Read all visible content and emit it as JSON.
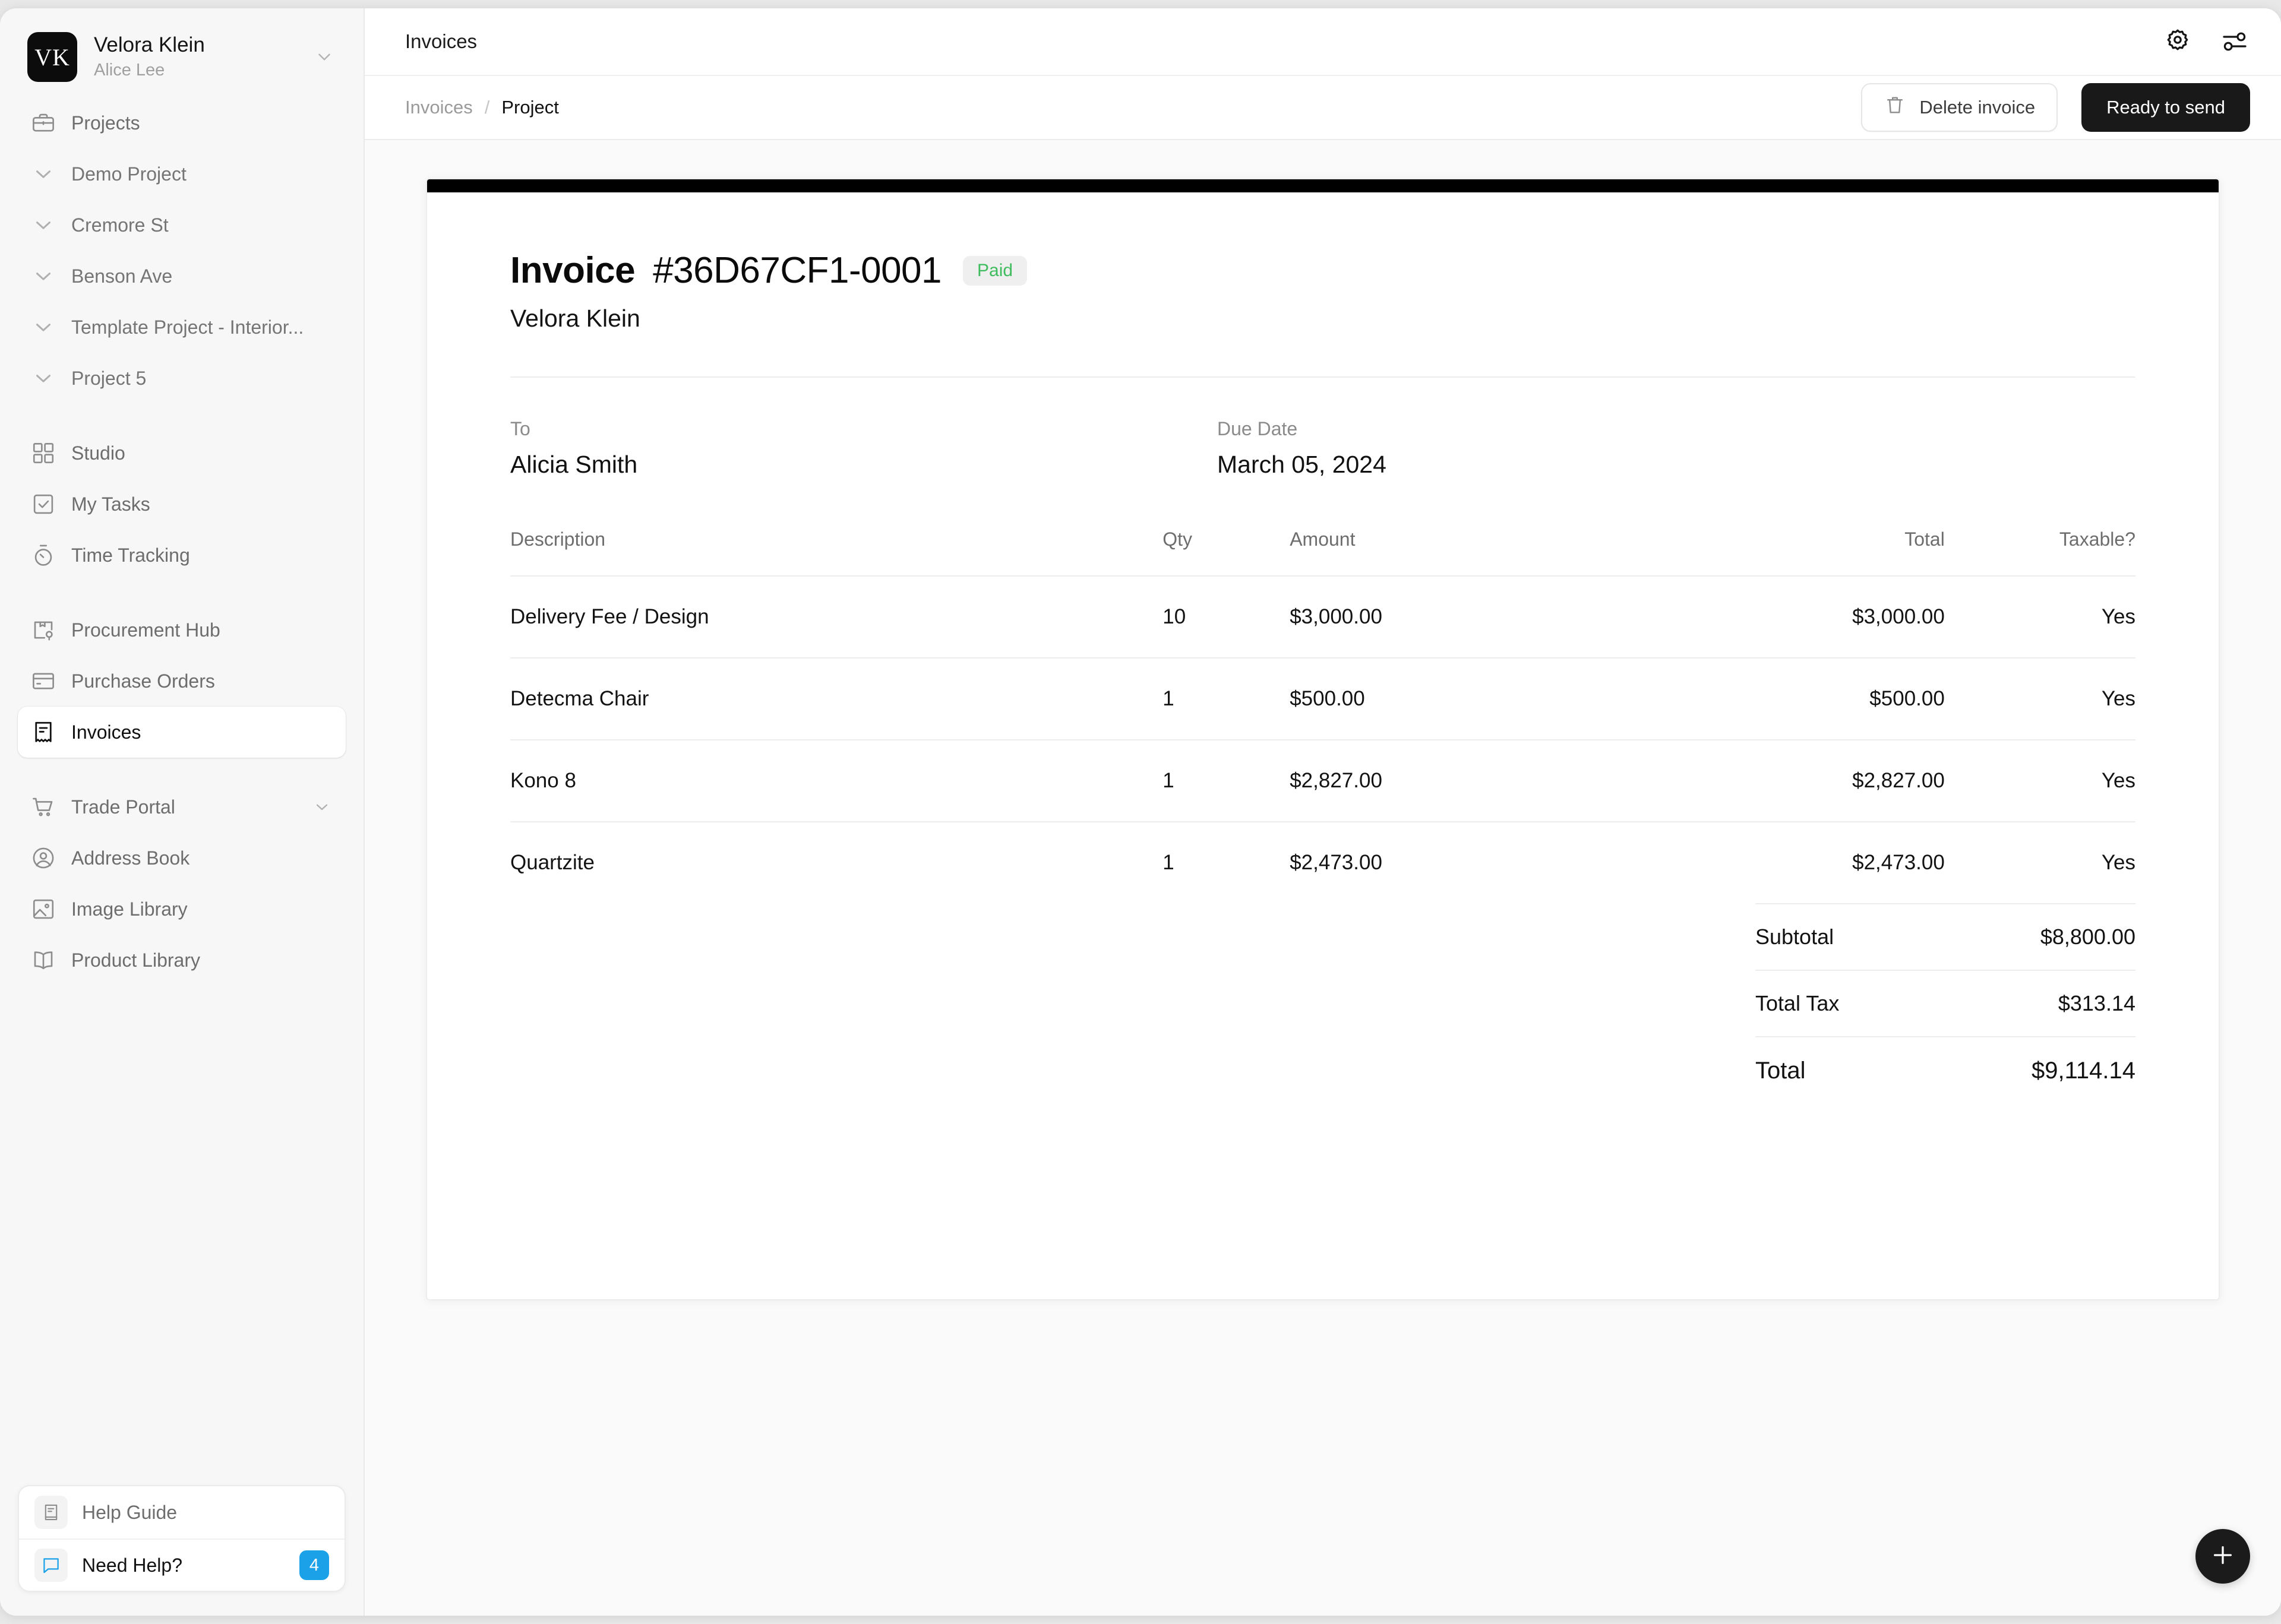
{
  "workspace": {
    "initials": "VK",
    "name": "Velora Klein",
    "user": "Alice Lee"
  },
  "sidebar": {
    "primary": [
      {
        "label": "Projects",
        "icon": "briefcase-icon",
        "type": "item"
      }
    ],
    "projects": [
      {
        "label": "Demo Project",
        "icon": "chevron-down-icon"
      },
      {
        "label": "Cremore St",
        "icon": "chevron-down-icon"
      },
      {
        "label": "Benson Ave",
        "icon": "chevron-down-icon"
      },
      {
        "label": "Template Project - Interior...",
        "icon": "chevron-down-icon"
      },
      {
        "label": "Project 5",
        "icon": "chevron-down-icon"
      }
    ],
    "group_two": [
      {
        "label": "Studio",
        "icon": "grid-icon"
      },
      {
        "label": "My Tasks",
        "icon": "checkbox-icon"
      },
      {
        "label": "Time Tracking",
        "icon": "stopwatch-icon"
      }
    ],
    "group_three": [
      {
        "label": "Procurement Hub",
        "icon": "package-pin-icon",
        "active": false
      },
      {
        "label": "Purchase Orders",
        "icon": "card-icon",
        "active": false
      },
      {
        "label": "Invoices",
        "icon": "receipt-icon",
        "active": true
      }
    ],
    "group_four": [
      {
        "label": "Trade Portal",
        "icon": "cart-icon",
        "expandable": true
      },
      {
        "label": "Address Book",
        "icon": "user-circle-icon",
        "expandable": false
      },
      {
        "label": "Image Library",
        "icon": "image-icon",
        "expandable": false
      },
      {
        "label": "Product Library",
        "icon": "book-icon",
        "expandable": false
      }
    ],
    "help": {
      "guide_label": "Help Guide",
      "need_help_label": "Need Help?",
      "need_help_count": "4"
    }
  },
  "topbar": {
    "title": "Invoices",
    "settings_icon": "gear-icon",
    "filters_icon": "sliders-icon"
  },
  "subbar": {
    "breadcrumb_root": "Invoices",
    "breadcrumb_sep": "/",
    "breadcrumb_current": "Project",
    "delete_label": "Delete invoice",
    "primary_label": "Ready to send"
  },
  "invoice": {
    "title": "Invoice",
    "number": "#36D67CF1-0001",
    "status": "Paid",
    "status_color": "#3fbc5d",
    "vendor": "Velora Klein",
    "to_label": "To",
    "to_value": "Alicia Smith",
    "due_label": "Due Date",
    "due_value": "March 05, 2024",
    "columns": [
      "Description",
      "Qty",
      "Amount",
      "Total",
      "Taxable?"
    ],
    "rows": [
      {
        "description": "Delivery Fee / Design",
        "qty": "10",
        "amount": "$3,000.00",
        "total": "$3,000.00",
        "taxable": "Yes"
      },
      {
        "description": "Detecma Chair",
        "qty": "1",
        "amount": "$500.00",
        "total": "$500.00",
        "taxable": "Yes"
      },
      {
        "description": "Kono 8",
        "qty": "1",
        "amount": "$2,827.00",
        "total": "$2,827.00",
        "taxable": "Yes"
      },
      {
        "description": "Quartzite",
        "qty": "1",
        "amount": "$2,473.00",
        "total": "$2,473.00",
        "taxable": "Yes"
      }
    ],
    "totals": [
      {
        "label": "Subtotal",
        "value": "$8,800.00"
      },
      {
        "label": "Total Tax",
        "value": "$313.14"
      },
      {
        "label": "Total",
        "value": "$9,114.14"
      }
    ]
  },
  "fab": {
    "icon": "plus-icon"
  }
}
